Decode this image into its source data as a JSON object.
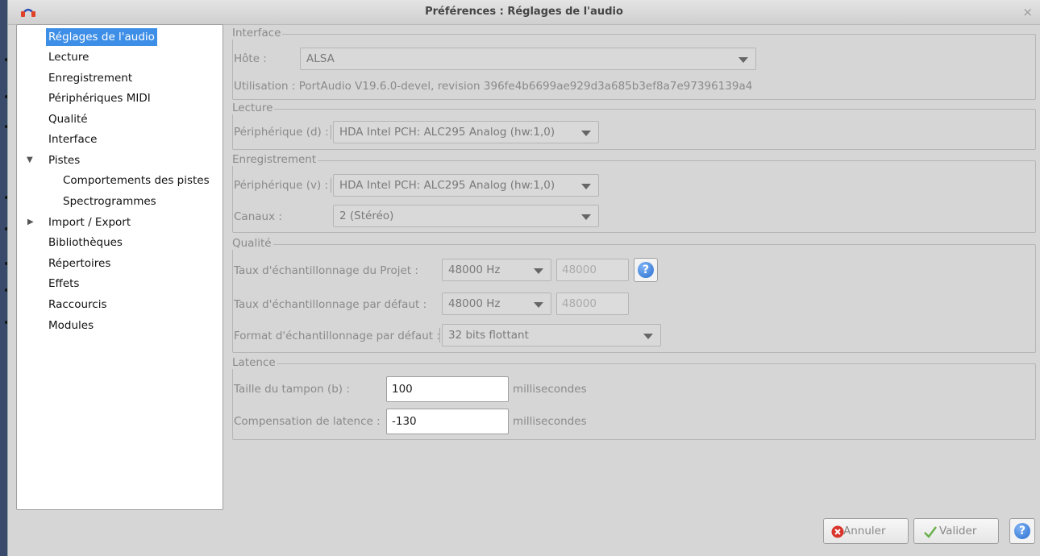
{
  "window": {
    "title": "Préférences : Réglages de l'audio",
    "close": "×"
  },
  "tree": {
    "items": [
      {
        "label": "Réglages de l'audio"
      },
      {
        "label": "Lecture"
      },
      {
        "label": "Enregistrement"
      },
      {
        "label": "Périphériques MIDI"
      },
      {
        "label": "Qualité"
      },
      {
        "label": "Interface"
      },
      {
        "label": "Pistes"
      },
      {
        "label": "Comportements des pistes"
      },
      {
        "label": "Spectrogrammes"
      },
      {
        "label": "Import / Export"
      },
      {
        "label": "Bibliothèques"
      },
      {
        "label": "Répertoires"
      },
      {
        "label": "Effets"
      },
      {
        "label": "Raccourcis"
      },
      {
        "label": "Modules"
      }
    ]
  },
  "interface": {
    "title": "Interface",
    "host_label": "Hôte :",
    "host_value": "ALSA",
    "usage": "Utilisation : PortAudio V19.6.0-devel, revision 396fe4b6699ae929d3a685b3ef8a7e97396139a4"
  },
  "playback": {
    "title": "Lecture",
    "device_label": "Périphérique (d) :",
    "device_value": "HDA Intel PCH: ALC295 Analog (hw:1,0)"
  },
  "recording": {
    "title": "Enregistrement",
    "device_label": "Périphérique (v) :",
    "device_value": "HDA Intel PCH: ALC295 Analog (hw:1,0)",
    "channels_label": "Canaux :",
    "channels_value": "2 (Stéréo)"
  },
  "quality": {
    "title": "Qualité",
    "project_rate_label": "Taux d'échantillonnage du Projet :",
    "project_rate_value": "48000 Hz",
    "project_rate_field": "48000",
    "default_rate_label": "Taux d'échantillonnage par défaut :",
    "default_rate_value": "48000 Hz",
    "default_rate_field": "48000",
    "format_label": "Format d'échantillonnage par défaut :",
    "format_value": "32 bits flottant"
  },
  "latency": {
    "title": "Latence",
    "buffer_label": "Taille du tampon (b) :",
    "buffer_value": "100",
    "buffer_unit": "millisecondes",
    "compensation_label": "Compensation de latence :",
    "compensation_value": "-130",
    "compensation_unit": "millisecondes"
  },
  "buttons": {
    "cancel": "Annuler",
    "ok": "Valider",
    "help": "?"
  },
  "colors": {
    "selection": "#3d8ee6",
    "help_blue": "#2a6fd0",
    "cancel_red": "#d9342b",
    "ok_green": "#6ab04c"
  }
}
